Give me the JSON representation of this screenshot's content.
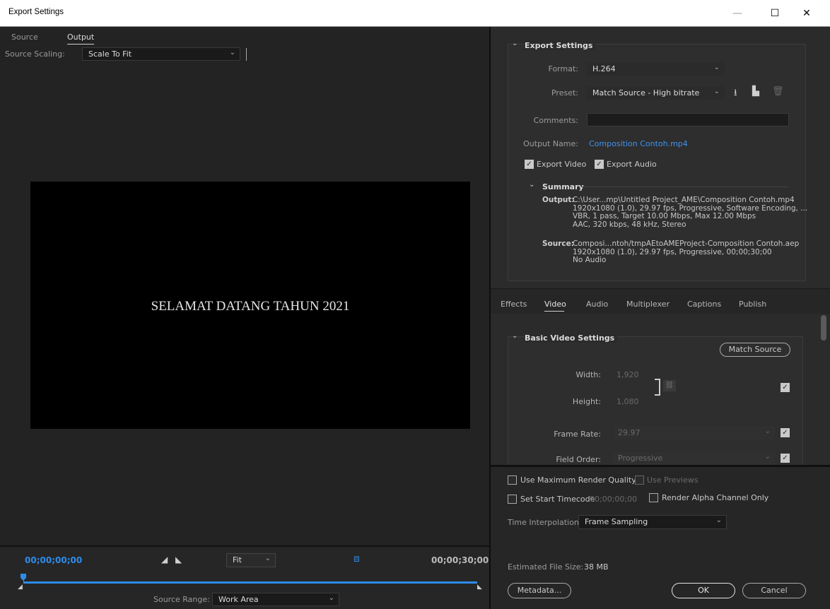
{
  "window": {
    "title": "Export Settings",
    "minimize_icon": "minimize-icon",
    "maximize_icon": "maximize-icon",
    "close_icon": "close-icon"
  },
  "left": {
    "tabs": [
      {
        "label": "Source"
      },
      {
        "label": "Output"
      }
    ],
    "source_scaling": {
      "label": "Source Scaling:",
      "value": "Scale To Fit"
    },
    "preview_text": "SELAMAT DATANG TAHUN 2021",
    "timeline": {
      "start_tc": "00;00;00;00",
      "end_tc": "00;00;30;00",
      "fit_value": "Fit",
      "source_range_label": "Source Range:",
      "source_range_value": "Work Area",
      "playhead_position": 0
    }
  },
  "export_settings": {
    "heading": "Export Settings",
    "format_label": "Format:",
    "format_value": "H.264",
    "preset_label": "Preset:",
    "preset_value": "Match Source - High bitrate",
    "comments_label": "Comments:",
    "comments_value": "",
    "output_name_label": "Output Name:",
    "output_name_value": "Composition Contoh.mp4",
    "export_video_label": "Export Video",
    "export_video_checked": true,
    "export_audio_label": "Export Audio",
    "export_audio_checked": true,
    "summary_heading": "Summary",
    "summary_output_label": "Output:",
    "summary_output_lines": [
      "C:\\User...mp\\Untitled Project_AME\\Composition Contoh.mp4",
      "1920x1080 (1.0), 29.97 fps, Progressive, Software Encoding, ...",
      "VBR, 1 pass, Target 10.00 Mbps, Max 12.00 Mbps",
      "AAC, 320 kbps, 48 kHz, Stereo"
    ],
    "summary_source_label": "Source:",
    "summary_source_lines": [
      "Composi...ntoh/tmpAEtoAMEProject-Composition Contoh.aep",
      "1920x1080 (1.0), 29.97 fps, Progressive, 00;00;30;00",
      "No Audio"
    ]
  },
  "tabs2": [
    {
      "label": "Effects"
    },
    {
      "label": "Video"
    },
    {
      "label": "Audio"
    },
    {
      "label": "Multiplexer"
    },
    {
      "label": "Captions"
    },
    {
      "label": "Publish"
    }
  ],
  "video": {
    "heading": "Basic Video Settings",
    "match_source": "Match Source",
    "width_label": "Width:",
    "width_value": "1,920",
    "height_label": "Height:",
    "height_value": "1,080",
    "frame_rate_label": "Frame Rate:",
    "frame_rate_value": "29.97",
    "field_order_label": "Field Order:",
    "field_order_value": "Progressive"
  },
  "bottom": {
    "max_render_quality": "Use Maximum Render Quality",
    "use_previews": "Use Previews",
    "set_start_timecode": "Set Start Timecode",
    "start_timecode_value": "00;00;00;00",
    "render_alpha": "Render Alpha Channel Only",
    "time_interpolation_label": "Time Interpolation:",
    "time_interpolation_value": "Frame Sampling",
    "estimated_size_label": "Estimated File Size:",
    "estimated_size_value": "38 MB",
    "metadata_button": "Metadata...",
    "ok_button": "OK",
    "cancel_button": "Cancel"
  },
  "colors": {
    "accent_blue": "#2d8ceb",
    "link_blue": "#3e93f2",
    "panel_bg": "#2b2b2b",
    "left_bg": "#232323"
  }
}
